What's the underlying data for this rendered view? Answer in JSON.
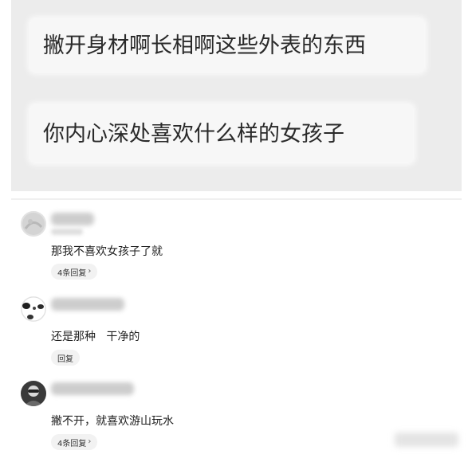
{
  "post": {
    "line1": "撇开身材啊长相啊这些外表的东西",
    "line2": "你内心深处喜欢什么样的女孩子"
  },
  "comments": [
    {
      "text": "那我不喜欢女孩子了就",
      "reply_label": "4条回复",
      "has_chevron": true,
      "avatar_icon": "avatar-icon"
    },
    {
      "text": "还是那种   干净的",
      "reply_label": "回复",
      "has_chevron": false,
      "avatar_icon": "avatar-icon"
    },
    {
      "text": "撇不开，就喜欢游山玩水",
      "reply_label": "4条回复",
      "has_chevron": true,
      "avatar_icon": "avatar-icon"
    }
  ],
  "icons": {
    "chevron": "›"
  },
  "colors": {
    "panel_bg": "#ececec",
    "bubble_bg": "#f7f7f7",
    "pill_bg": "#f2f2f2"
  }
}
